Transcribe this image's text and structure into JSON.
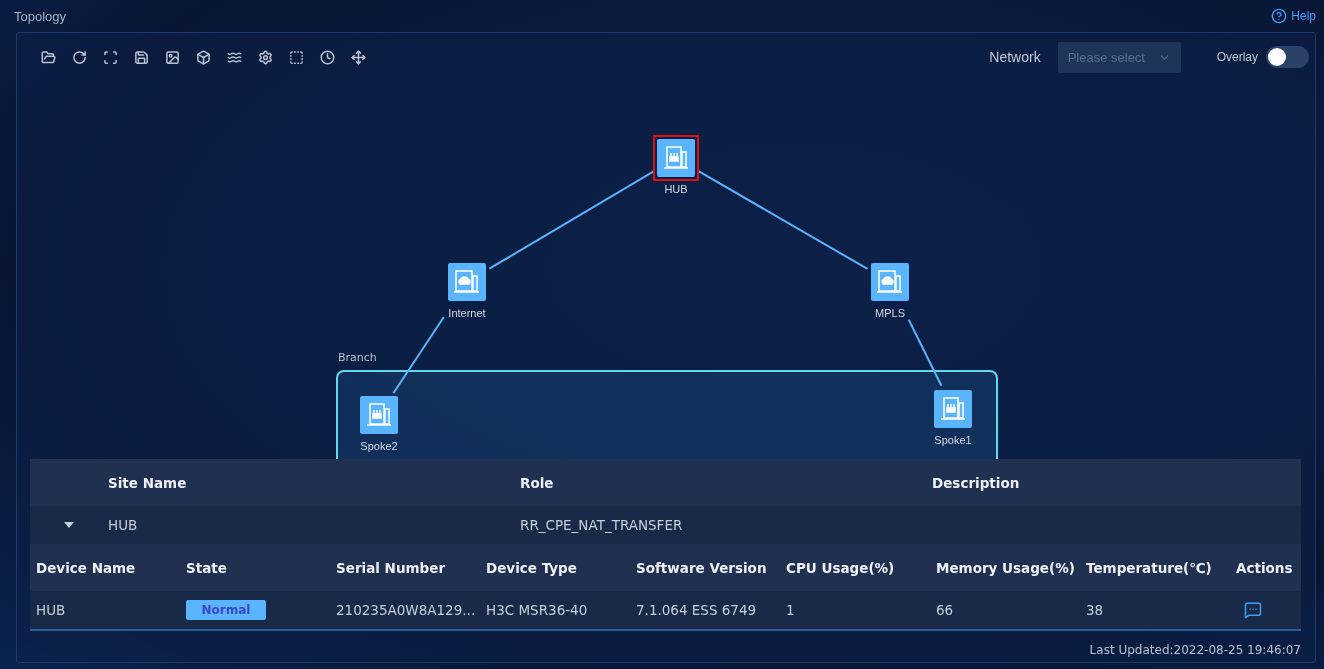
{
  "page": {
    "title": "Topology",
    "help": "Help"
  },
  "toolbar": {
    "network_label": "Network",
    "network_select": {
      "placeholder": "Please select"
    },
    "overlay": {
      "label": "Overlay",
      "on": false
    }
  },
  "topology": {
    "group": {
      "label": "Branch"
    },
    "nodes": [
      {
        "name": "HUB",
        "kind": "router",
        "selected": true
      },
      {
        "name": "Internet",
        "kind": "cloud",
        "selected": false
      },
      {
        "name": "MPLS",
        "kind": "cloud",
        "selected": false
      },
      {
        "name": "Spoke2",
        "kind": "router",
        "selected": false
      },
      {
        "name": "Spoke1",
        "kind": "router",
        "selected": false
      }
    ]
  },
  "site_table": {
    "columns": [
      "Site Name",
      "Role",
      "Description"
    ],
    "rows": [
      {
        "site_name": "HUB",
        "role": "RR_CPE_NAT_TRANSFER",
        "expanded": true,
        "devices": {
          "columns": [
            "Device Name",
            "State",
            "Serial Number",
            "Device Type",
            "Software Version",
            "CPU Usage(%)",
            "Memory Usage(%)",
            "Temperature(℃)",
            "Actions"
          ],
          "rows": [
            {
              "device_name": "HUB",
              "state": "Normal",
              "serial": "210235A0W8A129...",
              "device_type": "H3C MSR36-40",
              "software": "7.1.064 ESS 6749",
              "cpu": "1",
              "memory": "66",
              "temperature": "38"
            }
          ]
        }
      }
    ]
  },
  "footer": {
    "last_updated": "Last Updated:2022-08-25 19:46:07"
  }
}
